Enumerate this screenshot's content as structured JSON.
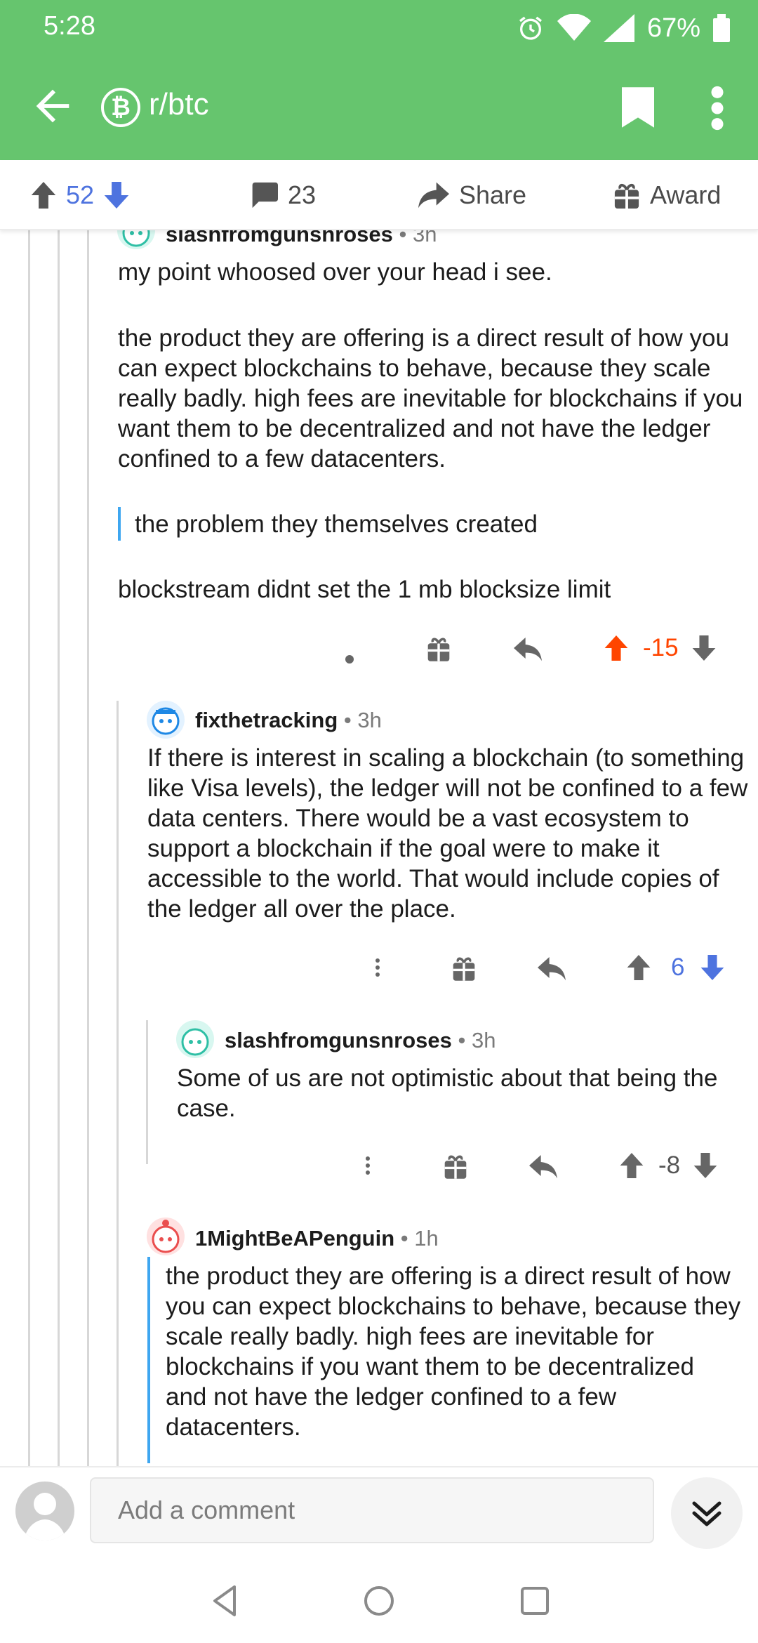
{
  "status_bar": {
    "time": "5:28",
    "battery": "67%"
  },
  "app_bar": {
    "subreddit": "r/btc",
    "sub_icon_letter": "₿"
  },
  "post_actions": {
    "upvotes": "52",
    "comments": "23",
    "share": "Share",
    "award": "Award"
  },
  "comments": [
    {
      "author": "slashfromgunsnroses",
      "time": "3h",
      "paragraphs": [
        "my point whoosed over your head i see.",
        "the product they are offering is a direct result of how you can expect blockchains to behave, because they scale really badly. high fees are inevitable for blockchains if you want them to be decentralized and not have the ledger confined to a few datacenters."
      ],
      "quote": "the problem they themselves created",
      "closing": "blockstream didnt set the 1 mb blocksize limit",
      "score": "-15"
    },
    {
      "author": "fixthetracking",
      "time": "3h",
      "text": "If there is interest in scaling a blockchain (to something like Visa levels), the ledger will not be confined to a few data centers. There would be a vast ecosystem to support a blockchain if the goal were to make it accessible to the world. That would include copies of the ledger all over the place.",
      "score": "6"
    },
    {
      "author": "slashfromgunsnroses",
      "time": "3h",
      "text": "Some of us are not optimistic about that being the case.",
      "score": "-8"
    },
    {
      "author": "1MightBeAPenguin",
      "time": "1h",
      "quote": "the product they are offering is a direct result of how you can expect blockchains to behave, because they scale really badly. high fees are inevitable for blockchains if you want them to be decentralized and not have the ledger confined to a few datacenters."
    }
  ],
  "comment_bar": {
    "placeholder": "Add a comment"
  },
  "colors": {
    "brand_green": "#66c56e",
    "upvote_orange": "#ff4500",
    "downvote_blue": "#4e73df",
    "quote_blue": "#3ea6f0"
  },
  "icons": [
    "back-arrow-icon",
    "bitcoin-icon",
    "bookmark-icon",
    "more-vert-icon",
    "upvote-icon",
    "downvote-icon",
    "comment-icon",
    "share-icon",
    "gift-icon",
    "reply-icon",
    "chevron-double-down-icon",
    "nav-back-icon",
    "nav-home-icon",
    "nav-recents-icon"
  ]
}
